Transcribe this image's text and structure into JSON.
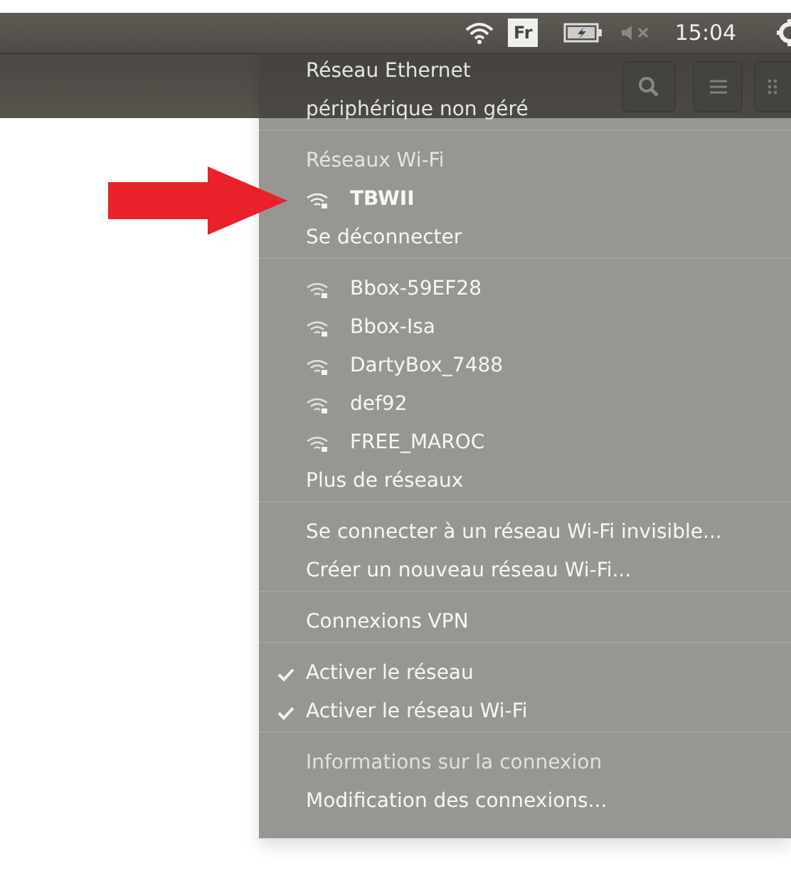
{
  "top_panel": {
    "keyboard_layout": "Fr",
    "clock": "15:04"
  },
  "network_menu": {
    "items": [
      {
        "kind": "header",
        "label": "Réseau Ethernet"
      },
      {
        "kind": "header",
        "label": "périphérique non géré"
      },
      {
        "kind": "separator"
      },
      {
        "kind": "header",
        "label": "Réseaux Wi-Fi"
      },
      {
        "kind": "network",
        "label": "TBWII",
        "connected": true
      },
      {
        "kind": "item",
        "label": "Se déconnecter",
        "disabled": false
      },
      {
        "kind": "separator"
      },
      {
        "kind": "network",
        "label": "Bbox-59EF28",
        "connected": false
      },
      {
        "kind": "network",
        "label": "Bbox-Isa",
        "connected": false
      },
      {
        "kind": "network",
        "label": "DartyBox_7488",
        "connected": false
      },
      {
        "kind": "network",
        "label": "def92",
        "connected": false
      },
      {
        "kind": "network",
        "label": "FREE_MAROC",
        "connected": false
      },
      {
        "kind": "item",
        "label": "Plus de réseaux",
        "disabled": false
      },
      {
        "kind": "separator"
      },
      {
        "kind": "item",
        "label": "Se connecter à un réseau Wi-Fi invisible...",
        "disabled": false
      },
      {
        "kind": "item",
        "label": "Créer un nouveau réseau Wi-Fi...",
        "disabled": false
      },
      {
        "kind": "separator"
      },
      {
        "kind": "item",
        "label": "Connexions VPN",
        "disabled": false
      },
      {
        "kind": "separator"
      },
      {
        "kind": "check",
        "label": "Activer le réseau",
        "checked": true
      },
      {
        "kind": "check",
        "label": "Activer le réseau Wi-Fi",
        "checked": true
      },
      {
        "kind": "separator"
      },
      {
        "kind": "item",
        "label": "Informations sur la connexion",
        "disabled": true
      },
      {
        "kind": "item",
        "label": "Modification des connexions...",
        "disabled": false
      }
    ]
  }
}
